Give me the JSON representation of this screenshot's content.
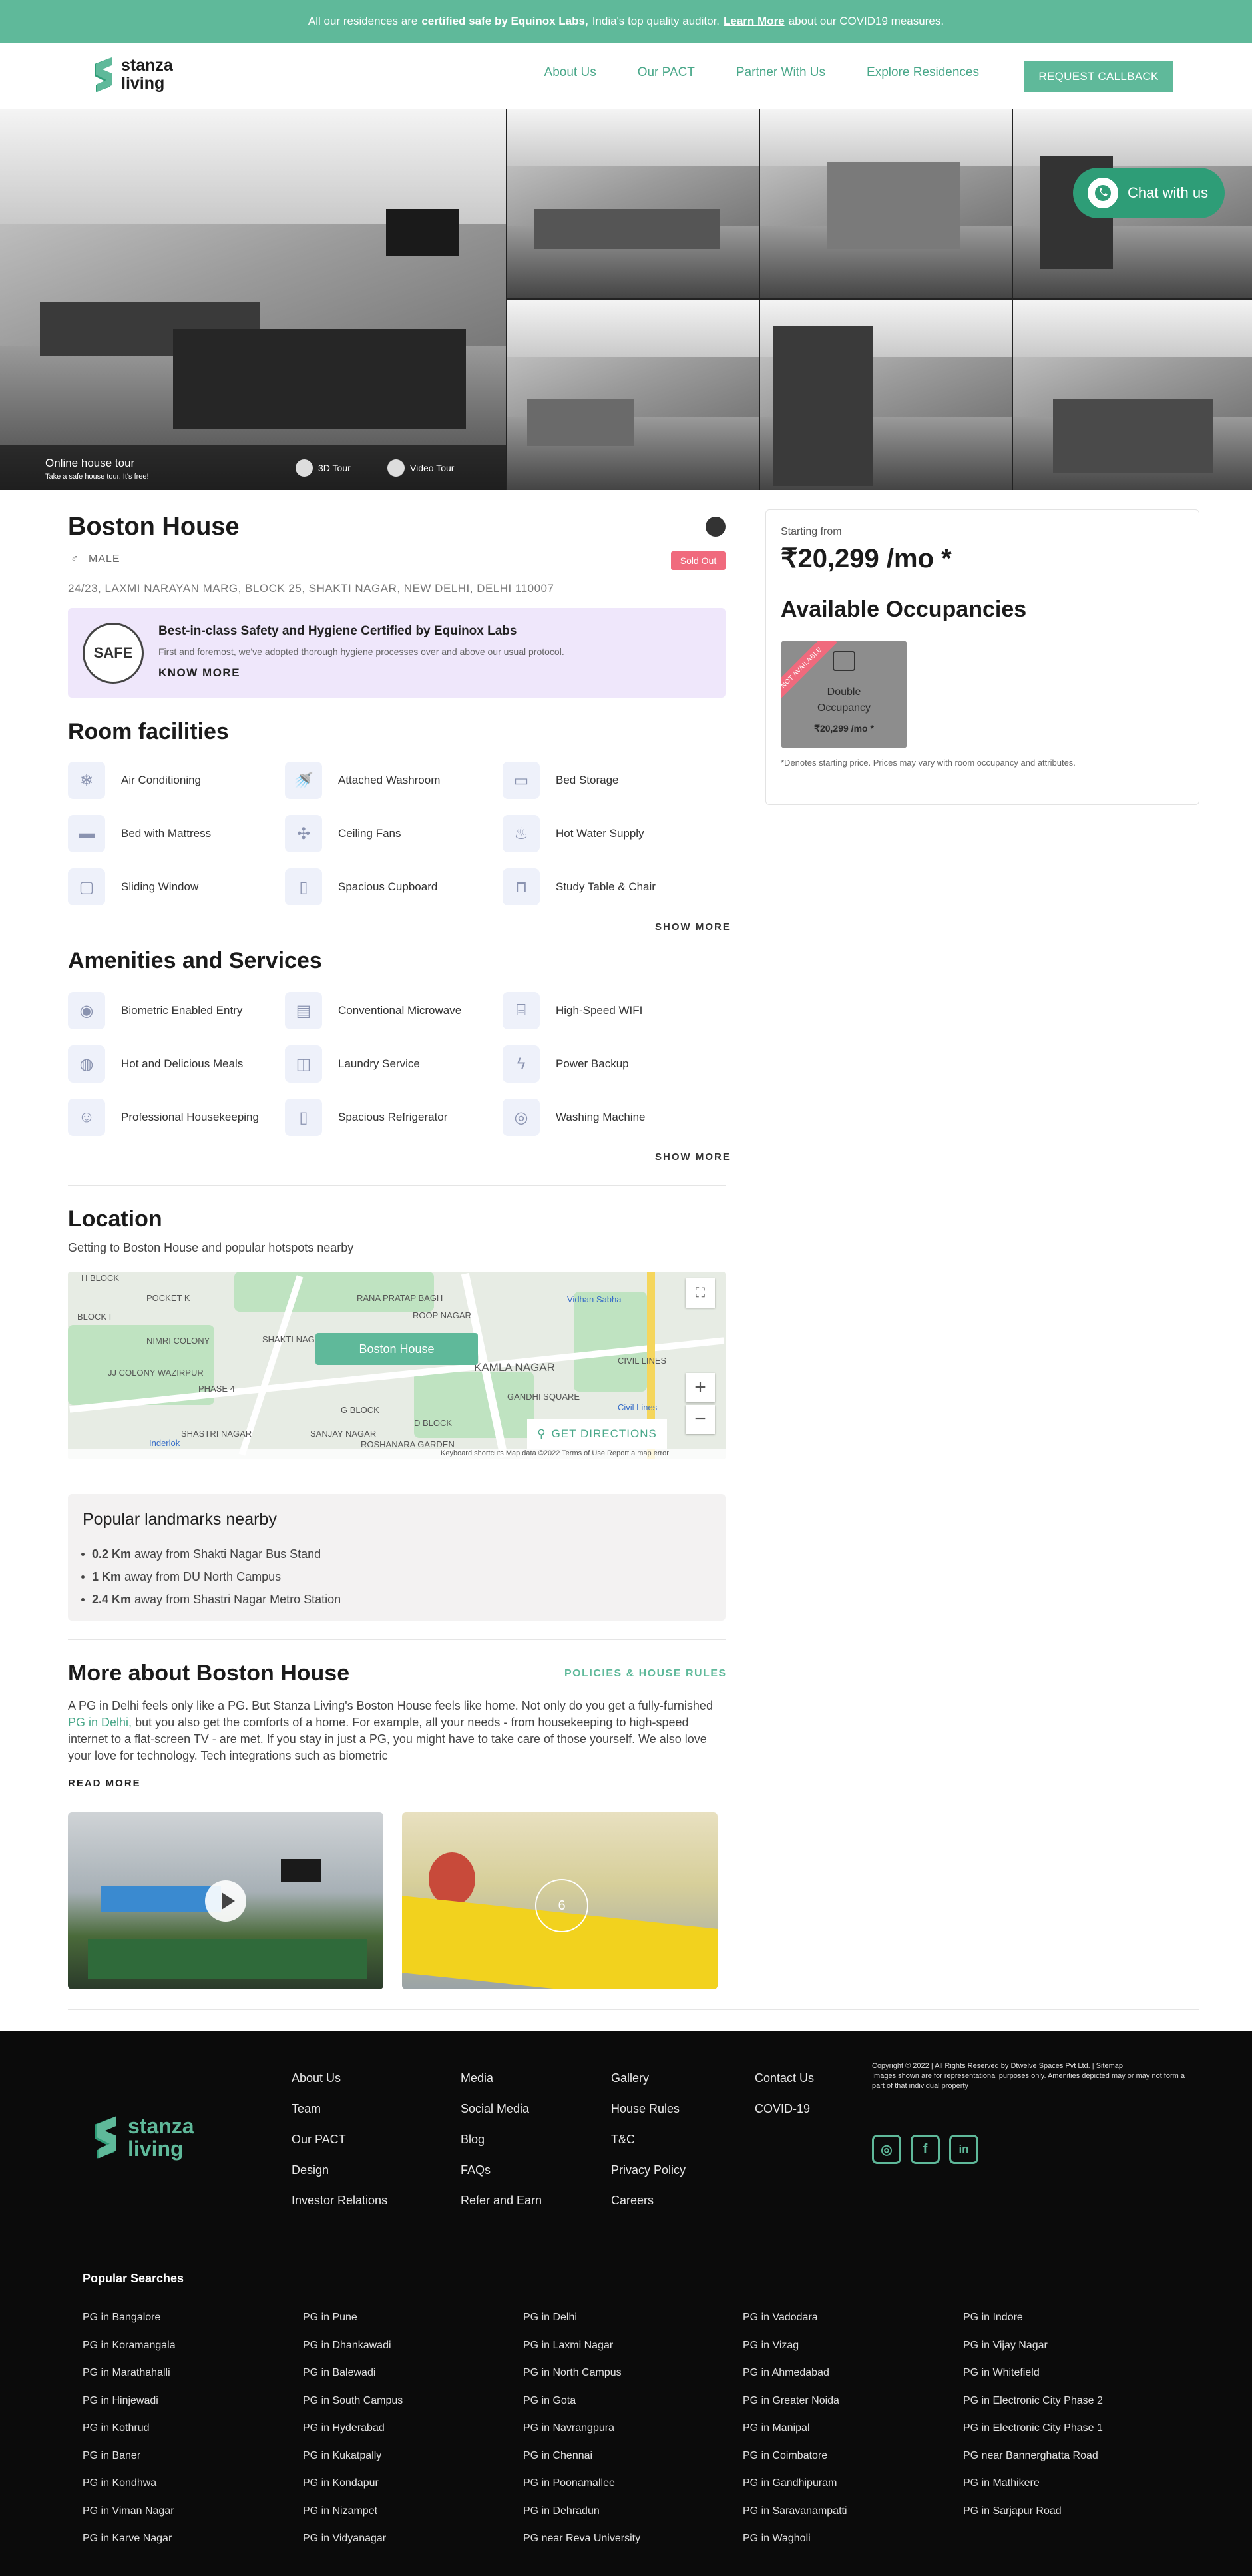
{
  "banner": {
    "pre": "All our residences are",
    "bold": "certified safe by Equinox Labs,",
    "mid": "India's top quality auditor.",
    "link": "Learn More",
    "post": "about our COVID19 measures."
  },
  "header": {
    "logo_line1": "stanza",
    "logo_line2": "living",
    "nav": [
      "About Us",
      "Our PACT",
      "Partner With Us",
      "Explore Residences"
    ],
    "cta": "REQUEST CALLBACK"
  },
  "gallery": {
    "tour_title": "Online house tour",
    "tour_sub": "Take a safe house tour. It's free!",
    "btn_3d": "3D Tour",
    "btn_video": "Video Tour"
  },
  "chat": {
    "label": "Chat with us"
  },
  "property": {
    "name": "Boston House",
    "gender": "MALE",
    "status": "Sold Out",
    "address": "24/23, LAXMI NARAYAN MARG, BLOCK 25, SHAKTI NAGAR, NEW DELHI, DELHI 110007"
  },
  "safety": {
    "badge": "SAFE",
    "heading": "Best-in-class Safety and Hygiene Certified by Equinox Labs",
    "desc": "First and foremost, we've adopted thorough hygiene processes over and above our usual protocol.",
    "link": "KNOW MORE"
  },
  "room_facilities": {
    "heading": "Room facilities",
    "items": [
      "Air Conditioning",
      "Attached Washroom",
      "Bed Storage",
      "Bed with Mattress",
      "Ceiling Fans",
      "Hot Water Supply",
      "Sliding Window",
      "Spacious Cupboard",
      "Study Table & Chair"
    ],
    "show_more": "SHOW MORE"
  },
  "amenities": {
    "heading": "Amenities and Services",
    "items": [
      "Biometric Enabled Entry",
      "Conventional Microwave",
      "High-Speed WIFI",
      "Hot and Delicious Meals",
      "Laundry Service",
      "Power Backup",
      "Professional Housekeeping",
      "Spacious Refrigerator",
      "Washing Machine"
    ],
    "show_more": "SHOW MORE"
  },
  "location": {
    "heading": "Location",
    "sub": "Getting to Boston House and popular hotspots nearby",
    "pin": "Boston House",
    "directions": "GET DIRECTIONS",
    "map_footer": "Keyboard shortcuts   Map data ©2022   Terms of Use   Report a map error",
    "map_labels": [
      "H BLOCK",
      "POCKET K",
      "BLOCK I",
      "NIMRI COLONY",
      "JJ COLONY WAZIRPUR",
      "PHASE 4",
      "SHAKTI NAGAR EXTENSION",
      "RANA PRATAP BAGH",
      "ROOP NAGAR",
      "KAMLA NAGAR",
      "Vidhan Sabha",
      "CIVIL LINES",
      "G BLOCK",
      "D BLOCK",
      "SANJAY NAGAR",
      "SHASTRI NAGAR",
      "ROSHANARA GARDEN",
      "Inderlok",
      "GANDHI SQUARE",
      "Civil Lines"
    ]
  },
  "landmarks": {
    "heading": "Popular landmarks nearby",
    "items": [
      {
        "dist": "0.2 Km",
        "text": "away from Shakti Nagar Bus Stand"
      },
      {
        "dist": "1 Km",
        "text": "away from DU North Campus"
      },
      {
        "dist": "2.4 Km",
        "text": "away from Shastri Nagar Metro Station"
      }
    ]
  },
  "about": {
    "heading": "More about Boston House",
    "policies": "POLICIES & HOUSE RULES",
    "p1": "A PG in Delhi feels only like a PG. But Stanza Living's Boston House feels like home. Not only do you get a fully-furnished",
    "link": "PG in Delhi,",
    "p2": "but you also get the comforts of a home. For example, all your needs - from housekeeping to high-speed internet to a flat-screen TV - are met. If you stay in just a PG, you might have to take care of those yourself. We also love your love for technology. Tech integrations such as biometric",
    "read_more": "READ MORE",
    "photo_count": "6"
  },
  "pricing": {
    "starting_from": "Starting from",
    "price": "₹20,299 /mo *",
    "occ_heading": "Available Occupancies",
    "occ_status": "NOT AVAILABLE",
    "occ_name_1": "Double",
    "occ_name_2": "Occupancy",
    "occ_price": "₹20,299 /mo *",
    "note": "*Denotes starting price. Prices may vary with room occupancy and attributes."
  },
  "footer": {
    "logo_line1": "stanza",
    "logo_line2": "living",
    "col1": [
      "About Us",
      "Team",
      "Our PACT",
      "Design",
      "Investor Relations"
    ],
    "col2": [
      "Media",
      "Social Media",
      "Blog",
      "FAQs",
      "Refer and Earn"
    ],
    "col3": [
      "Gallery",
      "House Rules",
      "T&C",
      "Privacy Policy",
      "Careers"
    ],
    "col4": [
      "Contact Us",
      "COVID-19"
    ],
    "copyright": "Copyright © 2022 | All Rights Reserved by Dtwelve Spaces Pvt Ltd. | Sitemap",
    "disclaimer": "Images shown are for representational purposes only. Amenities depicted may or may not form a part of that individual property",
    "social": [
      "instagram-icon",
      "facebook-icon",
      "linkedin-icon"
    ],
    "popular_heading": "Popular Searches",
    "popular": [
      [
        "PG in Bangalore",
        "PG in Koramangala",
        "PG in Marathahalli",
        "PG in Hinjewadi",
        "PG in Kothrud",
        "PG in Baner",
        "PG in Kondhwa",
        "PG in Viman Nagar",
        "PG in Karve Nagar"
      ],
      [
        "PG in Pune",
        "PG in Dhankawadi",
        "PG in Balewadi",
        "PG in South Campus",
        "PG in Hyderabad",
        "PG in Kukatpally",
        "PG in Kondapur",
        "PG in Nizampet",
        "PG in Vidyanagar"
      ],
      [
        "PG in Delhi",
        "PG in Laxmi Nagar",
        "PG in North Campus",
        "PG in Gota",
        "PG in Navrangpura",
        "PG in Chennai",
        "PG in Poonamallee",
        "PG in Dehradun",
        "PG near Reva University"
      ],
      [
        "PG in Vadodara",
        "PG in Vizag",
        "PG in Ahmedabad",
        "PG in Greater Noida",
        "PG in Manipal",
        "PG in Coimbatore",
        "PG in Gandhipuram",
        "PG in Saravanampatti",
        "PG in Wagholi"
      ],
      [
        "PG in Indore",
        "PG in Vijay Nagar",
        "PG in Whitefield",
        "PG in Electronic City Phase 2",
        "PG in Electronic City Phase 1",
        "PG near Bannerghatta Road",
        "PG in Mathikere",
        "PG in Sarjapur Road"
      ]
    ]
  },
  "colors": {
    "brand_green": "#5fb99a",
    "sold_out": "#f06a7d",
    "safety_bg": "#efe7fb",
    "footer_bg": "#0b0b0b"
  }
}
